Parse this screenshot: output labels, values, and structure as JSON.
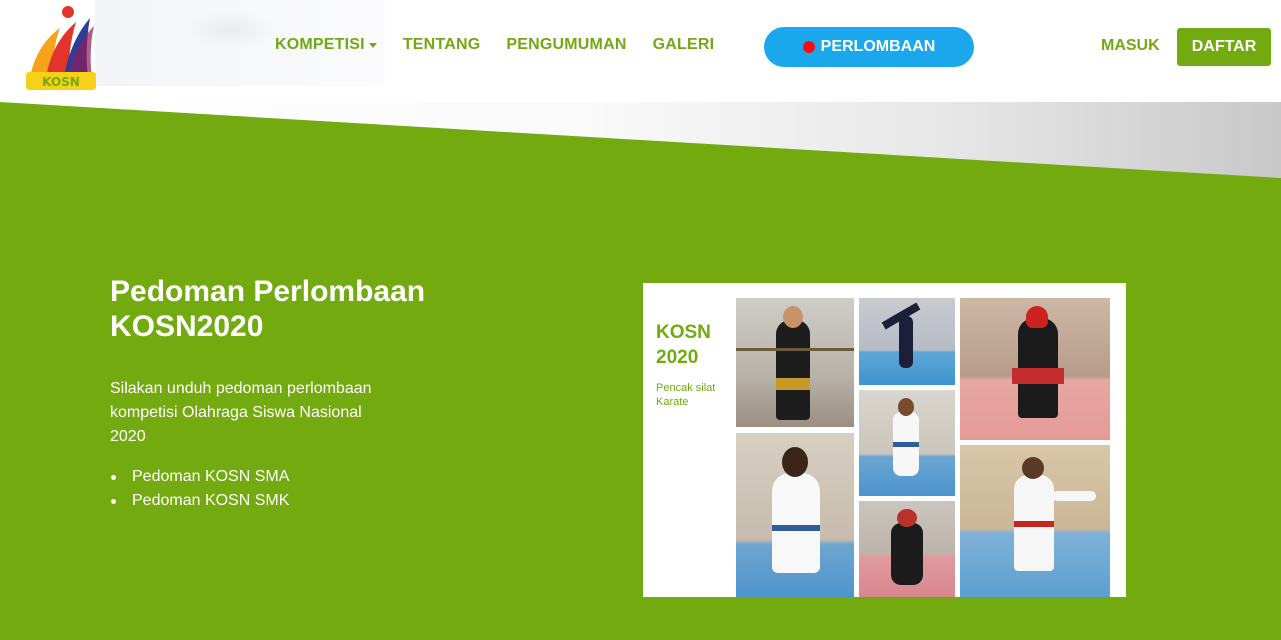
{
  "header": {
    "logo_text": "KOSN",
    "nav": [
      {
        "label": "KOMPETISI",
        "dropdown": true
      },
      {
        "label": "TENTANG"
      },
      {
        "label": "PENGUMUMAN"
      },
      {
        "label": "GALERI"
      }
    ],
    "cta_label": "PERLOMBAAN",
    "login_label": "MASUK",
    "register_label": "DAFTAR"
  },
  "hero": {
    "title_line1": "Pedoman Perlombaan",
    "title_line2": "KOSN2020",
    "description": "Silakan unduh pedoman perlombaan kompetisi Olahraga Siswa Nasional 2020",
    "links": [
      "Pedoman KOSN SMA",
      "Pedoman KOSN SMK"
    ]
  },
  "card": {
    "title_line1": "KOSN",
    "title_line2": "2020",
    "sub_line1": "Pencak silat",
    "sub_line2": "Karate"
  },
  "colors": {
    "brand_green": "#72aa10",
    "cta_blue": "#1aa7ec",
    "live_red": "#ff0a0a"
  }
}
